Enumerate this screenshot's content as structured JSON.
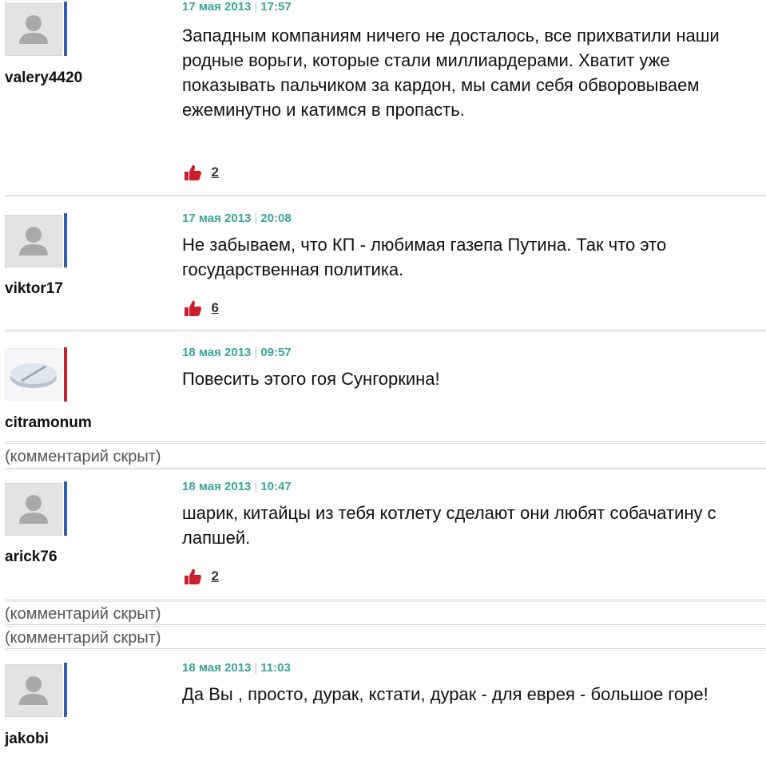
{
  "comments": [
    {
      "username": "valery4420",
      "date": "17 мая 2013",
      "time": "17:57",
      "text": "Западным компаниям ничего не досталось, все прихватили наши родные ворьги, которые стали миллиардерами. Хватит уже показывать пальчиком за кардон, мы сами себя обворовываем ежеминутно и катимся в пропасть.",
      "likes": "2",
      "avatar": "default-user-icon",
      "accent_color": "#2f5fb4"
    },
    {
      "username": "viktor17",
      "date": "17 мая 2013",
      "time": "20:08",
      "text": "Не забываем, что КП - любимая газепа Путина. Так что это государственная политика.",
      "likes": "6",
      "avatar": "default-user-icon",
      "accent_color": "#2f5fb4"
    },
    {
      "username": "citramonum",
      "date": "18 мая 2013",
      "time": "09:57",
      "text": "Повесить этого гоя Сунгоркина!",
      "avatar": "pill-icon",
      "accent_color": "#cc1f2d"
    },
    {
      "username": "arick76",
      "date": "18 мая 2013",
      "time": "10:47",
      "text": "шарик, китайцы из тебя котлету сделают они любят собачатину с лапшей.",
      "likes": "2",
      "avatar": "default-user-icon",
      "accent_color": "#2f5fb4"
    },
    {
      "username": "jakobi",
      "date": "18 мая 2013",
      "time": "11:03",
      "text": "Да Вы , просто, дурак, кстати, дурак - для еврея - большое горе!",
      "avatar": "default-user-icon",
      "accent_color": "#2f5fb4"
    }
  ],
  "hidden_comment_label": "(комментарий скрыт)",
  "time_separator": "|",
  "colors": {
    "meta": "#3aa39a",
    "like_icon": "#cc1f2d"
  }
}
